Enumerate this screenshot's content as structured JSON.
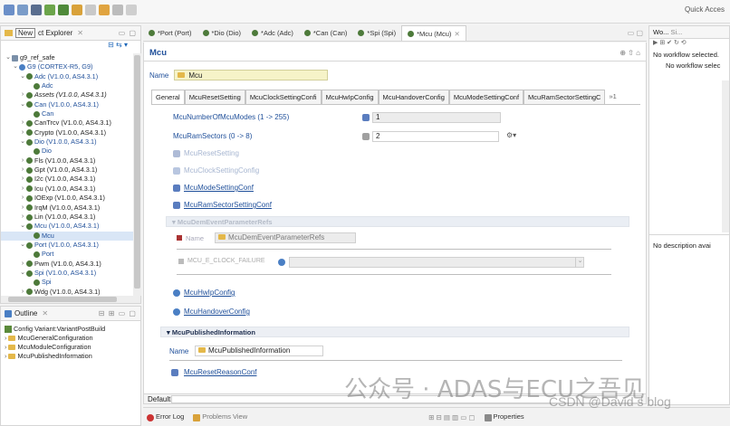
{
  "toolbar": {
    "quick_access": "Quick Acces"
  },
  "project_explorer": {
    "title_boxed": "New",
    "title_rest": "ct Explorer",
    "tree": [
      {
        "indent": 0,
        "tw": "v",
        "label": "g9_ref_safe",
        "italic": false,
        "bold": false
      },
      {
        "indent": 1,
        "tw": "v",
        "label": "G9 (CORTEX-R5, G9)",
        "italic": false,
        "bold": false
      },
      {
        "indent": 2,
        "tw": "v",
        "label": "Adc (V1.0.0, AS4.3.1)",
        "italic": false,
        "bold": false
      },
      {
        "indent": 3,
        "tw": "",
        "label": "Adc",
        "italic": false,
        "bold": false
      },
      {
        "indent": 2,
        "tw": ">",
        "label": "Assets (V1.0.0, AS4.3.1)",
        "italic": true,
        "bold": false
      },
      {
        "indent": 2,
        "tw": "v",
        "label": "Can (V1.0.0, AS4.3.1)",
        "italic": false,
        "bold": false
      },
      {
        "indent": 3,
        "tw": "",
        "label": "Can",
        "italic": false,
        "bold": false
      },
      {
        "indent": 2,
        "tw": ">",
        "label": "CanTrcv (V1.0.0, AS4.3.1)",
        "italic": false,
        "bold": false
      },
      {
        "indent": 2,
        "tw": ">",
        "label": "Crypto (V1.0.0, AS4.3.1)",
        "italic": false,
        "bold": false
      },
      {
        "indent": 2,
        "tw": "v",
        "label": "Dio (V1.0.0, AS4.3.1)",
        "italic": false,
        "bold": false
      },
      {
        "indent": 3,
        "tw": "",
        "label": "Dio",
        "italic": false,
        "bold": false
      },
      {
        "indent": 2,
        "tw": ">",
        "label": "Fls (V1.0.0, AS4.3.1)",
        "italic": false,
        "bold": false
      },
      {
        "indent": 2,
        "tw": ">",
        "label": "Gpt (V1.0.0, AS4.3.1)",
        "italic": false,
        "bold": false
      },
      {
        "indent": 2,
        "tw": ">",
        "label": "I2c (V1.0.0, AS4.3.1)",
        "italic": false,
        "bold": false
      },
      {
        "indent": 2,
        "tw": ">",
        "label": "Icu (V1.0.0, AS4.3.1)",
        "italic": false,
        "bold": false
      },
      {
        "indent": 2,
        "tw": ">",
        "label": "IOExp (V1.0.0, AS4.3.1)",
        "italic": false,
        "bold": false
      },
      {
        "indent": 2,
        "tw": ">",
        "label": "IrqM (V1.0.0, AS4.3.1)",
        "italic": false,
        "bold": false
      },
      {
        "indent": 2,
        "tw": ">",
        "label": "Lin (V1.0.0, AS4.3.1)",
        "italic": false,
        "bold": false
      },
      {
        "indent": 2,
        "tw": "v",
        "label": "Mcu (V1.0.0, AS4.3.1)",
        "italic": false,
        "bold": false
      },
      {
        "indent": 3,
        "tw": "",
        "label": "Mcu",
        "italic": false,
        "bold": false,
        "selected": true
      },
      {
        "indent": 2,
        "tw": "v",
        "label": "Port (V1.0.0, AS4.3.1)",
        "italic": false,
        "bold": false
      },
      {
        "indent": 3,
        "tw": "",
        "label": "Port",
        "italic": false,
        "bold": false
      },
      {
        "indent": 2,
        "tw": ">",
        "label": "Pwm (V1.0.0, AS4.3.1)",
        "italic": false,
        "bold": false
      },
      {
        "indent": 2,
        "tw": "v",
        "label": "Spi (V1.0.0, AS4.3.1)",
        "italic": false,
        "bold": false
      },
      {
        "indent": 3,
        "tw": "",
        "label": "Spi",
        "italic": false,
        "bold": false
      },
      {
        "indent": 2,
        "tw": ">",
        "label": "Wdg (V1.0.0, AS4.3.1)",
        "italic": false,
        "bold": false
      }
    ]
  },
  "outline": {
    "title": "Outline",
    "items": [
      {
        "label": "Config Variant:VariantPostBuild",
        "folder": false
      },
      {
        "label": "McuGeneralConfiguration",
        "folder": true
      },
      {
        "label": "McuModuleConfiguration",
        "folder": true
      },
      {
        "label": "McuPublishedInformation",
        "folder": true
      }
    ]
  },
  "editor_tabs": [
    {
      "label": "*Port (Port)",
      "active": false
    },
    {
      "label": "*Dio (Dio)",
      "active": false
    },
    {
      "label": "*Adc (Adc)",
      "active": false
    },
    {
      "label": "*Can (Can)",
      "active": false
    },
    {
      "label": "*Spi (Spi)",
      "active": false
    },
    {
      "label": "*Mcu (Mcu)",
      "active": true
    }
  ],
  "editor": {
    "title": "Mcu",
    "name_label": "Name",
    "name_value": "Mcu",
    "section_tabs": [
      {
        "label": "General",
        "active": true
      },
      {
        "label": "McuResetSetting",
        "active": false
      },
      {
        "label": "McuClockSettingConfi",
        "active": false
      },
      {
        "label": "McuHwIpConfig",
        "active": false
      },
      {
        "label": "McuHandoverConfig",
        "active": false
      },
      {
        "label": "McuModeSettingConf",
        "active": false
      },
      {
        "label": "McuRamSectorSettingC",
        "active": false
      },
      {
        "label": "»1",
        "active": false
      }
    ],
    "fields": {
      "num_modes_label": "McuNumberOfMcuModes (1 -> 255)",
      "num_modes_value": "1",
      "ram_sectors_label": "McuRamSectors (0 -> 8)",
      "ram_sectors_value": "2"
    },
    "links": {
      "reset_setting": "McuResetSetting",
      "clock_setting": "McuClockSettingConfig",
      "mode_setting": "McuModeSettingConf",
      "ram_sector": "McuRamSectorSettingConf",
      "hwip": "McuHwIpConfig",
      "handover": "McuHandoverConfig",
      "reset_reason": "McuResetReasonConf"
    },
    "dem_group": {
      "title": "McuDemEventParameterRefs",
      "name_label": "Name",
      "name_value": "McuDemEventParameterRefs",
      "failure_label": "MCU_E_CLOCK_FAILURE"
    },
    "published_group": {
      "title": "McuPublishedInformation",
      "name_label": "Name",
      "name_value": "McuPublishedInformation"
    },
    "default_label": "Default"
  },
  "bottom_bar": {
    "error_log": "Error Log",
    "problems": "Problems View",
    "properties": "Properties"
  },
  "right_panel": {
    "title": "Wo...",
    "title2": "Si...",
    "no_workflow": "No workflow selected.",
    "no_workflow2": "No workflow selec",
    "no_description": "No description avai"
  },
  "watermark": {
    "main": "公众号 · ADAS与ECU之吾见",
    "csdn": "CSDN @David  s blog"
  },
  "colors": {
    "accent_blue": "#1f4f9a",
    "name_yellow": "#f6f3c8",
    "selection": "#d9e6f6"
  }
}
